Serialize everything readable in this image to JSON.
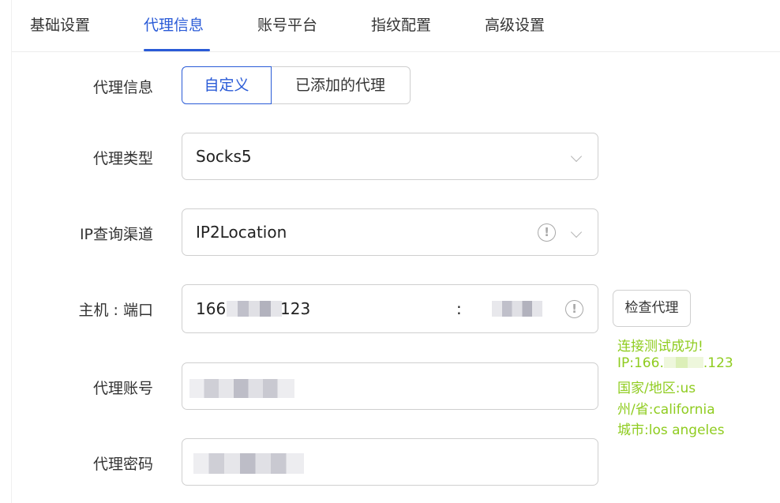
{
  "tabs": [
    "基础设置",
    "代理信息",
    "账号平台",
    "指纹配置",
    "高级设置"
  ],
  "active_tab": "代理信息",
  "form": {
    "proxy_info_label": "代理信息",
    "proxy_info_options": [
      "自定义",
      "已添加的代理"
    ],
    "proxy_info_selected": "自定义",
    "proxy_type_label": "代理类型",
    "proxy_type_value": "Socks5",
    "ip_channel_label": "IP查询渠道",
    "ip_channel_value": "IP2Location",
    "host_port_label": "主机 : 端口",
    "host_prefix": "166",
    "host_suffix": "123",
    "host_separator": ":",
    "account_label": "代理账号",
    "password_label": "代理密码"
  },
  "check_button": "检查代理",
  "result": {
    "line1": "连接测试成功!",
    "ip_prefix": "IP:166.",
    "ip_suffix": ".123",
    "country": "国家/地区:us",
    "state": "州/省:california",
    "city": "城市:los angeles"
  },
  "colors": {
    "accent": "#2a5bd7",
    "success": "#8fcc1f",
    "border": "#cfcfcf"
  },
  "icons": [
    "chevron-down-icon",
    "info-icon"
  ]
}
